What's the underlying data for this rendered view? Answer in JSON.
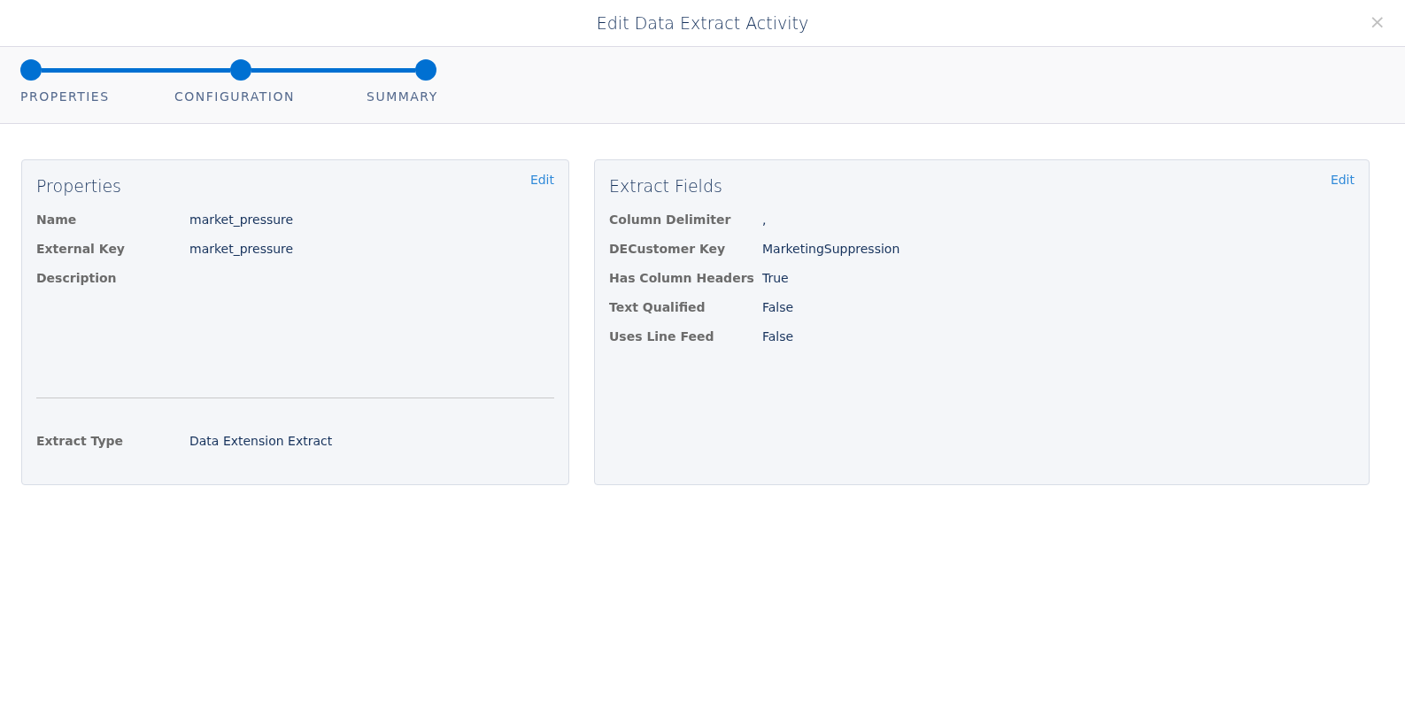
{
  "dialog": {
    "title": "Edit Data Extract Activity",
    "close": "×"
  },
  "steps": [
    {
      "label": "PROPERTIES",
      "completed": true
    },
    {
      "label": "CONFIGURATION",
      "completed": true
    },
    {
      "label": "SUMMARY",
      "completed": true
    }
  ],
  "cards": [
    {
      "title": "Properties",
      "edit": "Edit",
      "fields": [
        {
          "label": "Name",
          "value": "market_pressure"
        },
        {
          "label": "External Key",
          "value": "market_pressure"
        },
        {
          "label": "Description"
        }
      ],
      "footer_fields": [
        {
          "label": "Extract Type",
          "value": "Data Extension Extract"
        }
      ]
    },
    {
      "title": "Extract Fields",
      "edit": "Edit",
      "fields": [
        {
          "label": "Column Delimiter",
          "value": ","
        },
        {
          "label": "DECustomer Key",
          "value": "MarketingSuppression"
        },
        {
          "label": "Has Column Headers",
          "value": "True"
        },
        {
          "label": "Text Qualified",
          "value": "False"
        },
        {
          "label": "Uses Line Feed",
          "value": "False"
        }
      ]
    }
  ]
}
